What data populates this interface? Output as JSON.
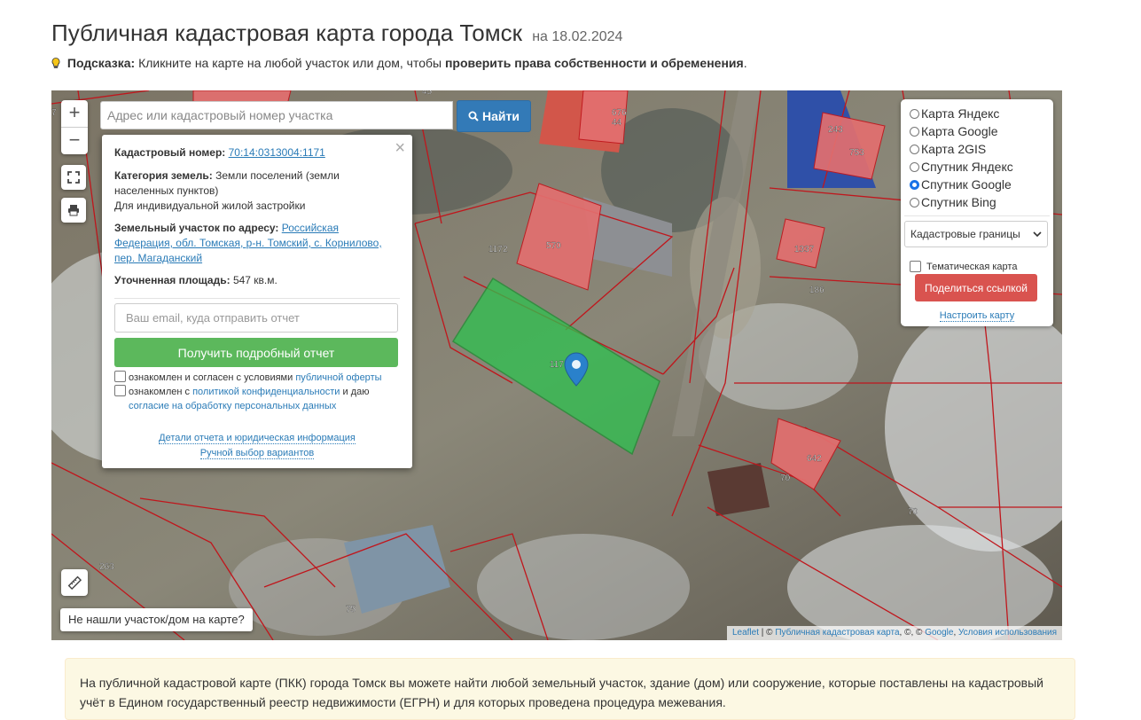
{
  "page": {
    "title": "Публичная кадастровая карта города Томск",
    "date": "на 18.02.2024",
    "hint_label": "Подсказка:",
    "hint_text": "Кликните на карте на любой участок или дом, чтобы",
    "hint_bold": "проверить права собственности и обременения",
    "hint_end": "."
  },
  "map": {
    "zoom_in": "+",
    "zoom_out": "−",
    "search_placeholder": "Адрес или кадастровый номер участка",
    "find_label": "Найти",
    "not_found": "Не нашли участок/дом на карте?",
    "attribution": {
      "leaflet": "Leaflet",
      "sep1": " | © ",
      "pkk": "Публичная кадастровая карта",
      "sep2": ", ©, © ",
      "google": "Google",
      "sep3": ", ",
      "terms": "Условия использования"
    },
    "parcel_labels": [
      "1172",
      "570",
      "676",
      "44",
      "243",
      "753",
      "1337",
      "186",
      "117",
      "642",
      "70",
      "70",
      "263",
      "75",
      "45",
      "7"
    ]
  },
  "popup": {
    "close": "×",
    "cad_label": "Кадастровый номер:",
    "cad_value": "70:14:0313004:1171",
    "cat_label": "Категория земель:",
    "cat_value": "Земли поселений (земли",
    "cat_value2": "населенных пунктов)",
    "use": "Для индивидуальной жилой застройки",
    "addr_label": "Земельный участок по адресу:",
    "addr_value1": "Российская",
    "addr_value2": "Федерация, обл. Томская, р-н. Томский, с. Корнилово,",
    "addr_value3": "пер. Магаданский",
    "area_label": "Уточненная площадь:",
    "area_value": "547 кв.м.",
    "email_placeholder": "Ваш email, куда отправить отчет",
    "report_button": "Получить подробный отчет",
    "agree1_text": "ознакомлен и согласен с условиями",
    "agree1_link": "публичной оферты",
    "agree2_text": "ознакомлен с",
    "agree2_link": "политикой конфиденциальности",
    "agree2_text2": "и даю",
    "agree2_link2": "согласие на обработку персональных данных",
    "details_link": "Детали отчета и юридическая информация",
    "manual_link": "Ручной выбор вариантов"
  },
  "layers": {
    "options": [
      {
        "label": "Карта Яндекс",
        "selected": false
      },
      {
        "label": "Карта Google",
        "selected": false
      },
      {
        "label": "Карта 2GIS",
        "selected": false
      },
      {
        "label": "Спутник Яндекс",
        "selected": false
      },
      {
        "label": "Спутник Google",
        "selected": true
      },
      {
        "label": "Спутник Bing",
        "selected": false
      }
    ],
    "overlay_select": "Кадастровые границы",
    "thematic": "Тематическая карта",
    "share": "Поделиться ссылкой",
    "setup": "Настроить карту"
  },
  "info": {
    "text": "На публичной кадастровой карте (ПКК) города Томск вы можете найти любой земельный участок, здание (дом) или сооружение, которые поставлены на кадастровый учёт в Едином государственный реестр недвижимости (ЕГРН) и для которых проведена процедура межевания."
  },
  "colors": {
    "primary": "#337ab7",
    "success": "#5cb85c",
    "danger": "#d9534f",
    "parcel_border": "#c0161c",
    "parcel_fill": "#e36f6f",
    "selected_fill": "#2ec24f"
  }
}
